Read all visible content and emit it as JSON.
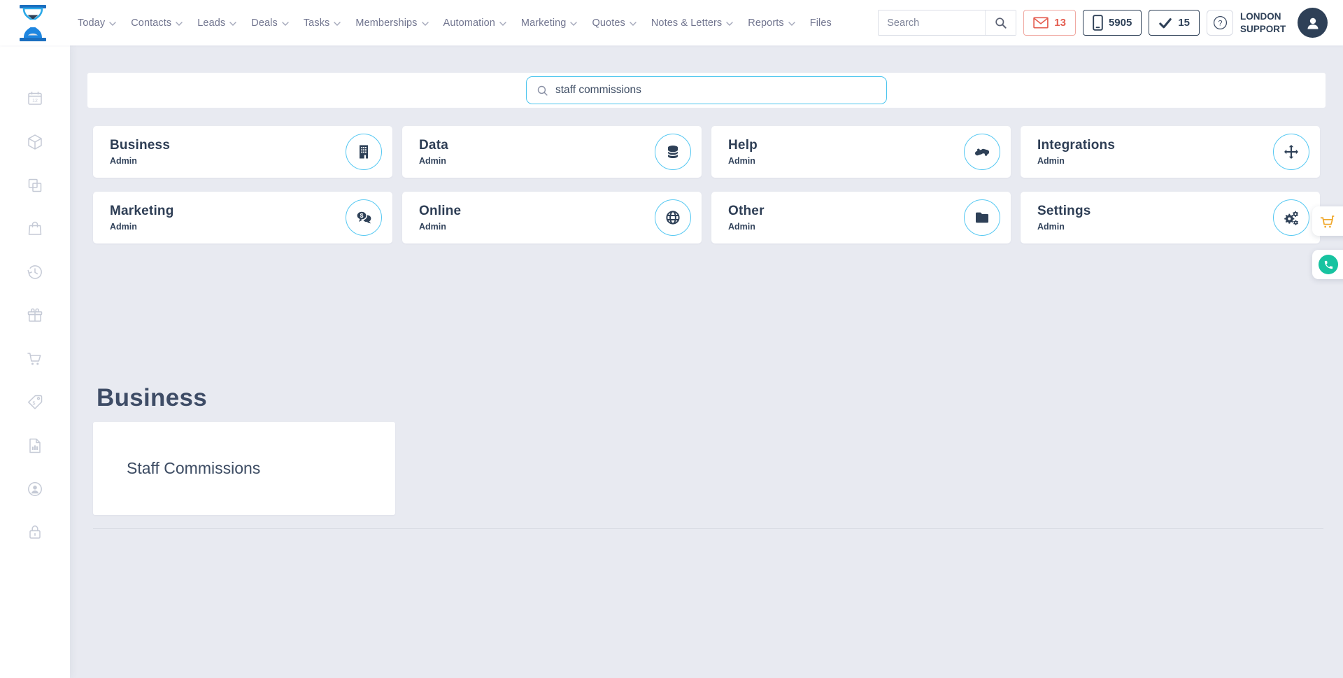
{
  "header": {
    "nav_items": [
      {
        "label": "Today",
        "dropdown": true
      },
      {
        "label": "Contacts",
        "dropdown": true
      },
      {
        "label": "Leads",
        "dropdown": true
      },
      {
        "label": "Deals",
        "dropdown": true
      },
      {
        "label": "Tasks",
        "dropdown": true
      },
      {
        "label": "Memberships",
        "dropdown": true
      },
      {
        "label": "Automation",
        "dropdown": true
      },
      {
        "label": "Marketing",
        "dropdown": true
      },
      {
        "label": "Quotes",
        "dropdown": true
      },
      {
        "label": "Notes & Letters",
        "dropdown": true
      },
      {
        "label": "Reports",
        "dropdown": true
      },
      {
        "label": "Files",
        "dropdown": false
      }
    ],
    "search": {
      "placeholder": "Search",
      "icon": "search-icon"
    },
    "badges": {
      "messages": {
        "icon": "envelope-icon",
        "count": "13",
        "color": "#e45d50"
      },
      "calls": {
        "icon": "mobile-phone-icon",
        "value": "5905"
      },
      "tasks": {
        "icon": "checkmark-icon",
        "count": "15"
      },
      "help": {
        "icon": "question-mark-icon"
      }
    },
    "user": {
      "name": "LONDON SUPPORT",
      "avatar_icon": "person-icon"
    }
  },
  "sidebar": {
    "icons": [
      "calendar-icon",
      "package-icon",
      "pages-icon",
      "shopping-bag-icon",
      "history-icon",
      "gift-icon",
      "cart-icon",
      "price-tag-icon",
      "report-icon",
      "account-icon",
      "lock-icon"
    ]
  },
  "main": {
    "search": {
      "value": "staff commissions",
      "icon": "search-icon"
    },
    "admin_cards": [
      {
        "title": "Business",
        "subtitle": "Admin",
        "icon": "building-icon"
      },
      {
        "title": "Data",
        "subtitle": "Admin",
        "icon": "database-icon"
      },
      {
        "title": "Help",
        "subtitle": "Admin",
        "icon": "handshake-icon"
      },
      {
        "title": "Integrations",
        "subtitle": "Admin",
        "icon": "move-arrows-icon"
      },
      {
        "title": "Marketing",
        "subtitle": "Admin",
        "icon": "chat-dollar-icon"
      },
      {
        "title": "Online",
        "subtitle": "Admin",
        "icon": "globe-icon"
      },
      {
        "title": "Other",
        "subtitle": "Admin",
        "icon": "folder-icon"
      },
      {
        "title": "Settings",
        "subtitle": "Admin",
        "icon": "gears-icon"
      }
    ],
    "results": {
      "heading": "Business",
      "items": [
        {
          "label": "Staff Commissions"
        }
      ]
    }
  },
  "floating_buttons": [
    {
      "icon": "cart-icon",
      "color": "#f0a92e"
    },
    {
      "icon": "phone-icon",
      "color": "#17c3a0"
    }
  ],
  "icon_glyphs": {
    "calendar_day": "12",
    "dollar": "$",
    "question": "?"
  },
  "colors": {
    "accent_blue": "#4cc5ee",
    "navy": "#2e4057",
    "background": "#e8eaf1",
    "badge_red": "#e45d50",
    "logo_blue": "#1b7fd4",
    "logo_light_blue": "#2ba9e8",
    "float_cart_orange": "#f0a92e",
    "float_phone_teal": "#17c3a0"
  }
}
